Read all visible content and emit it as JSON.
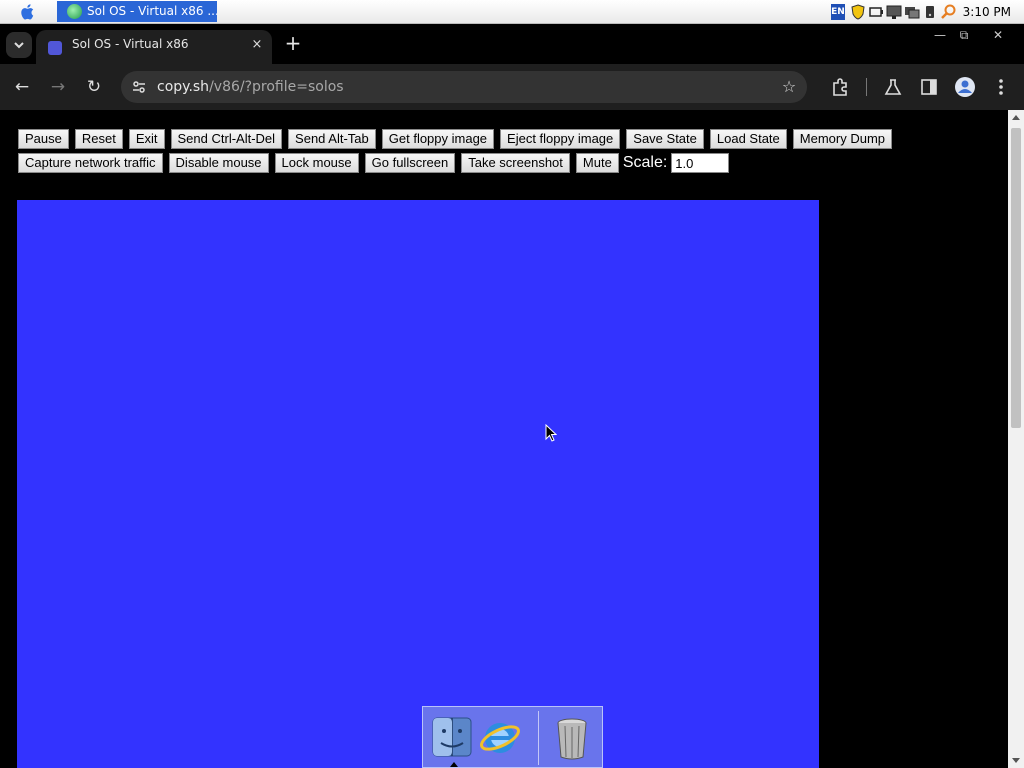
{
  "menubar": {
    "task_title": "Sol OS - Virtual x86 ...",
    "lang": "EN",
    "clock": "3:10 PM"
  },
  "browser": {
    "tab_title": "Sol OS - Virtual x86",
    "tab_close": "×",
    "new_tab": "+",
    "window": {
      "minimize": "—",
      "restore": "⧉",
      "close": "✕"
    },
    "url_host": "copy.sh",
    "url_path": "/v86/?profile=solos",
    "nav": {
      "back": "←",
      "forward": "→",
      "reload": "↻"
    },
    "star": "☆"
  },
  "controls": {
    "row1": [
      "Pause",
      "Reset",
      "Exit",
      "Send Ctrl-Alt-Del",
      "Send Alt-Tab",
      "Get floppy image",
      "Eject floppy image",
      "Save State",
      "Load State",
      "Memory Dump"
    ],
    "row2": [
      "Capture network traffic",
      "Disable mouse",
      "Lock mouse",
      "Go fullscreen",
      "Take screenshot",
      "Mute"
    ],
    "scale_label": "Scale:",
    "scale_value": "1.0"
  },
  "vm": {
    "background": "#3333ff",
    "dock_items": [
      "finder-icon",
      "internet-explorer-icon",
      "trash-icon"
    ]
  },
  "colors": {
    "taskbar_active": "#2a66d6",
    "browser_bg": "#1f1f1f"
  }
}
